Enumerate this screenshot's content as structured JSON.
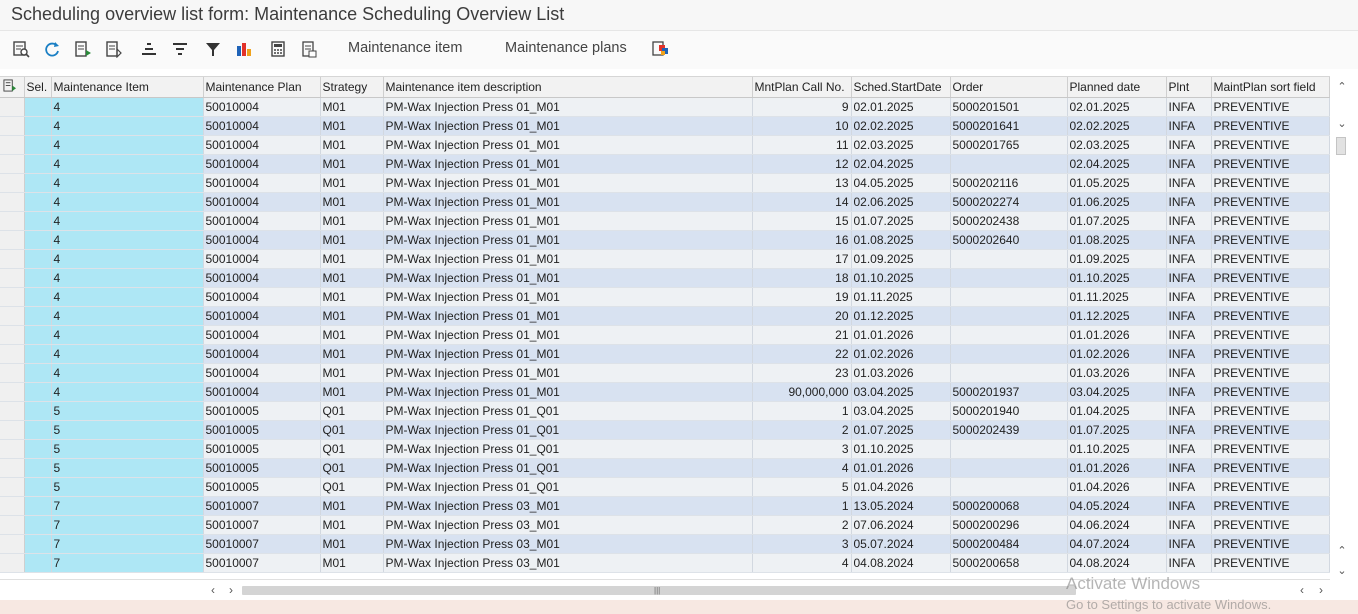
{
  "window": {
    "title": "Scheduling overview list form: Maintenance Scheduling Overview List"
  },
  "toolbar": {
    "icons": [
      "details-icon",
      "refresh-icon",
      "choose-layout-icon",
      "save-layout-icon",
      "sort-ascending-icon",
      "sort-descending-icon",
      "filter-icon",
      "graphic-icon",
      "print-icon",
      "export-icon",
      "multiple-objects-icon"
    ],
    "maintenance_item_label": "Maintenance item",
    "maintenance_plans_label": "Maintenance plans"
  },
  "table": {
    "columns": {
      "sel": "Sel.",
      "item": "Maintenance Item",
      "plan": "Maintenance Plan",
      "strategy": "Strategy",
      "desc": "Maintenance item description",
      "call": "MntPlan Call No.",
      "start": "Sched.StartDate",
      "order": "Order",
      "planned": "Planned date",
      "plnt": "Plnt",
      "sort": "MaintPlan sort field"
    },
    "rows": [
      {
        "item": "4",
        "plan": "50010004",
        "strategy": "M01",
        "desc": "PM-Wax Injection Press 01_M01",
        "call": "9",
        "start": "02.01.2025",
        "order": "5000201501",
        "planned": "02.01.2025",
        "plnt": "INFA",
        "sort": "PREVENTIVE"
      },
      {
        "item": "4",
        "plan": "50010004",
        "strategy": "M01",
        "desc": "PM-Wax Injection Press 01_M01",
        "call": "10",
        "start": "02.02.2025",
        "order": "5000201641",
        "planned": "02.02.2025",
        "plnt": "INFA",
        "sort": "PREVENTIVE"
      },
      {
        "item": "4",
        "plan": "50010004",
        "strategy": "M01",
        "desc": "PM-Wax Injection Press 01_M01",
        "call": "11",
        "start": "02.03.2025",
        "order": "5000201765",
        "planned": "02.03.2025",
        "plnt": "INFA",
        "sort": "PREVENTIVE"
      },
      {
        "item": "4",
        "plan": "50010004",
        "strategy": "M01",
        "desc": "PM-Wax Injection Press 01_M01",
        "call": "12",
        "start": "02.04.2025",
        "order": "",
        "planned": "02.04.2025",
        "plnt": "INFA",
        "sort": "PREVENTIVE"
      },
      {
        "item": "4",
        "plan": "50010004",
        "strategy": "M01",
        "desc": "PM-Wax Injection Press 01_M01",
        "call": "13",
        "start": "04.05.2025",
        "order": "5000202116",
        "planned": "01.05.2025",
        "plnt": "INFA",
        "sort": "PREVENTIVE"
      },
      {
        "item": "4",
        "plan": "50010004",
        "strategy": "M01",
        "desc": "PM-Wax Injection Press 01_M01",
        "call": "14",
        "start": "02.06.2025",
        "order": "5000202274",
        "planned": "01.06.2025",
        "plnt": "INFA",
        "sort": "PREVENTIVE"
      },
      {
        "item": "4",
        "plan": "50010004",
        "strategy": "M01",
        "desc": "PM-Wax Injection Press 01_M01",
        "call": "15",
        "start": "01.07.2025",
        "order": "5000202438",
        "planned": "01.07.2025",
        "plnt": "INFA",
        "sort": "PREVENTIVE"
      },
      {
        "item": "4",
        "plan": "50010004",
        "strategy": "M01",
        "desc": "PM-Wax Injection Press 01_M01",
        "call": "16",
        "start": "01.08.2025",
        "order": "5000202640",
        "planned": "01.08.2025",
        "plnt": "INFA",
        "sort": "PREVENTIVE"
      },
      {
        "item": "4",
        "plan": "50010004",
        "strategy": "M01",
        "desc": "PM-Wax Injection Press 01_M01",
        "call": "17",
        "start": "01.09.2025",
        "order": "",
        "planned": "01.09.2025",
        "plnt": "INFA",
        "sort": "PREVENTIVE"
      },
      {
        "item": "4",
        "plan": "50010004",
        "strategy": "M01",
        "desc": "PM-Wax Injection Press 01_M01",
        "call": "18",
        "start": "01.10.2025",
        "order": "",
        "planned": "01.10.2025",
        "plnt": "INFA",
        "sort": "PREVENTIVE"
      },
      {
        "item": "4",
        "plan": "50010004",
        "strategy": "M01",
        "desc": "PM-Wax Injection Press 01_M01",
        "call": "19",
        "start": "01.11.2025",
        "order": "",
        "planned": "01.11.2025",
        "plnt": "INFA",
        "sort": "PREVENTIVE"
      },
      {
        "item": "4",
        "plan": "50010004",
        "strategy": "M01",
        "desc": "PM-Wax Injection Press 01_M01",
        "call": "20",
        "start": "01.12.2025",
        "order": "",
        "planned": "01.12.2025",
        "plnt": "INFA",
        "sort": "PREVENTIVE"
      },
      {
        "item": "4",
        "plan": "50010004",
        "strategy": "M01",
        "desc": "PM-Wax Injection Press 01_M01",
        "call": "21",
        "start": "01.01.2026",
        "order": "",
        "planned": "01.01.2026",
        "plnt": "INFA",
        "sort": "PREVENTIVE"
      },
      {
        "item": "4",
        "plan": "50010004",
        "strategy": "M01",
        "desc": "PM-Wax Injection Press 01_M01",
        "call": "22",
        "start": "01.02.2026",
        "order": "",
        "planned": "01.02.2026",
        "plnt": "INFA",
        "sort": "PREVENTIVE"
      },
      {
        "item": "4",
        "plan": "50010004",
        "strategy": "M01",
        "desc": "PM-Wax Injection Press 01_M01",
        "call": "23",
        "start": "01.03.2026",
        "order": "",
        "planned": "01.03.2026",
        "plnt": "INFA",
        "sort": "PREVENTIVE"
      },
      {
        "item": "4",
        "plan": "50010004",
        "strategy": "M01",
        "desc": "PM-Wax Injection Press 01_M01",
        "call": "90,000,000",
        "start": "03.04.2025",
        "order": "5000201937",
        "planned": "03.04.2025",
        "plnt": "INFA",
        "sort": "PREVENTIVE"
      },
      {
        "item": "5",
        "plan": "50010005",
        "strategy": "Q01",
        "desc": "PM-Wax Injection Press 01_Q01",
        "call": "1",
        "start": "03.04.2025",
        "order": "5000201940",
        "planned": "01.04.2025",
        "plnt": "INFA",
        "sort": "PREVENTIVE"
      },
      {
        "item": "5",
        "plan": "50010005",
        "strategy": "Q01",
        "desc": "PM-Wax Injection Press 01_Q01",
        "call": "2",
        "start": "01.07.2025",
        "order": "5000202439",
        "planned": "01.07.2025",
        "plnt": "INFA",
        "sort": "PREVENTIVE"
      },
      {
        "item": "5",
        "plan": "50010005",
        "strategy": "Q01",
        "desc": "PM-Wax Injection Press 01_Q01",
        "call": "3",
        "start": "01.10.2025",
        "order": "",
        "planned": "01.10.2025",
        "plnt": "INFA",
        "sort": "PREVENTIVE"
      },
      {
        "item": "5",
        "plan": "50010005",
        "strategy": "Q01",
        "desc": "PM-Wax Injection Press 01_Q01",
        "call": "4",
        "start": "01.01.2026",
        "order": "",
        "planned": "01.01.2026",
        "plnt": "INFA",
        "sort": "PREVENTIVE"
      },
      {
        "item": "5",
        "plan": "50010005",
        "strategy": "Q01",
        "desc": "PM-Wax Injection Press 01_Q01",
        "call": "5",
        "start": "01.04.2026",
        "order": "",
        "planned": "01.04.2026",
        "plnt": "INFA",
        "sort": "PREVENTIVE"
      },
      {
        "item": "7",
        "plan": "50010007",
        "strategy": "M01",
        "desc": "PM-Wax Injection Press 03_M01",
        "call": "1",
        "start": "13.05.2024",
        "order": "5000200068",
        "planned": "04.05.2024",
        "plnt": "INFA",
        "sort": "PREVENTIVE"
      },
      {
        "item": "7",
        "plan": "50010007",
        "strategy": "M01",
        "desc": "PM-Wax Injection Press 03_M01",
        "call": "2",
        "start": "07.06.2024",
        "order": "5000200296",
        "planned": "04.06.2024",
        "plnt": "INFA",
        "sort": "PREVENTIVE"
      },
      {
        "item": "7",
        "plan": "50010007",
        "strategy": "M01",
        "desc": "PM-Wax Injection Press 03_M01",
        "call": "3",
        "start": "05.07.2024",
        "order": "5000200484",
        "planned": "04.07.2024",
        "plnt": "INFA",
        "sort": "PREVENTIVE"
      },
      {
        "item": "7",
        "plan": "50010007",
        "strategy": "M01",
        "desc": "PM-Wax Injection Press 03_M01",
        "call": "4",
        "start": "04.08.2024",
        "order": "5000200658",
        "planned": "04.08.2024",
        "plnt": "INFA",
        "sort": "PREVENTIVE"
      }
    ]
  },
  "watermark": {
    "line1": "Activate Windows",
    "line2": "Go to Settings to activate Windows."
  },
  "colors": {
    "selected_column": "#aee7f5",
    "row_light": "#eef1f4",
    "row_blue": "#d8e2f1",
    "header_bg": "#f2f2f2"
  }
}
